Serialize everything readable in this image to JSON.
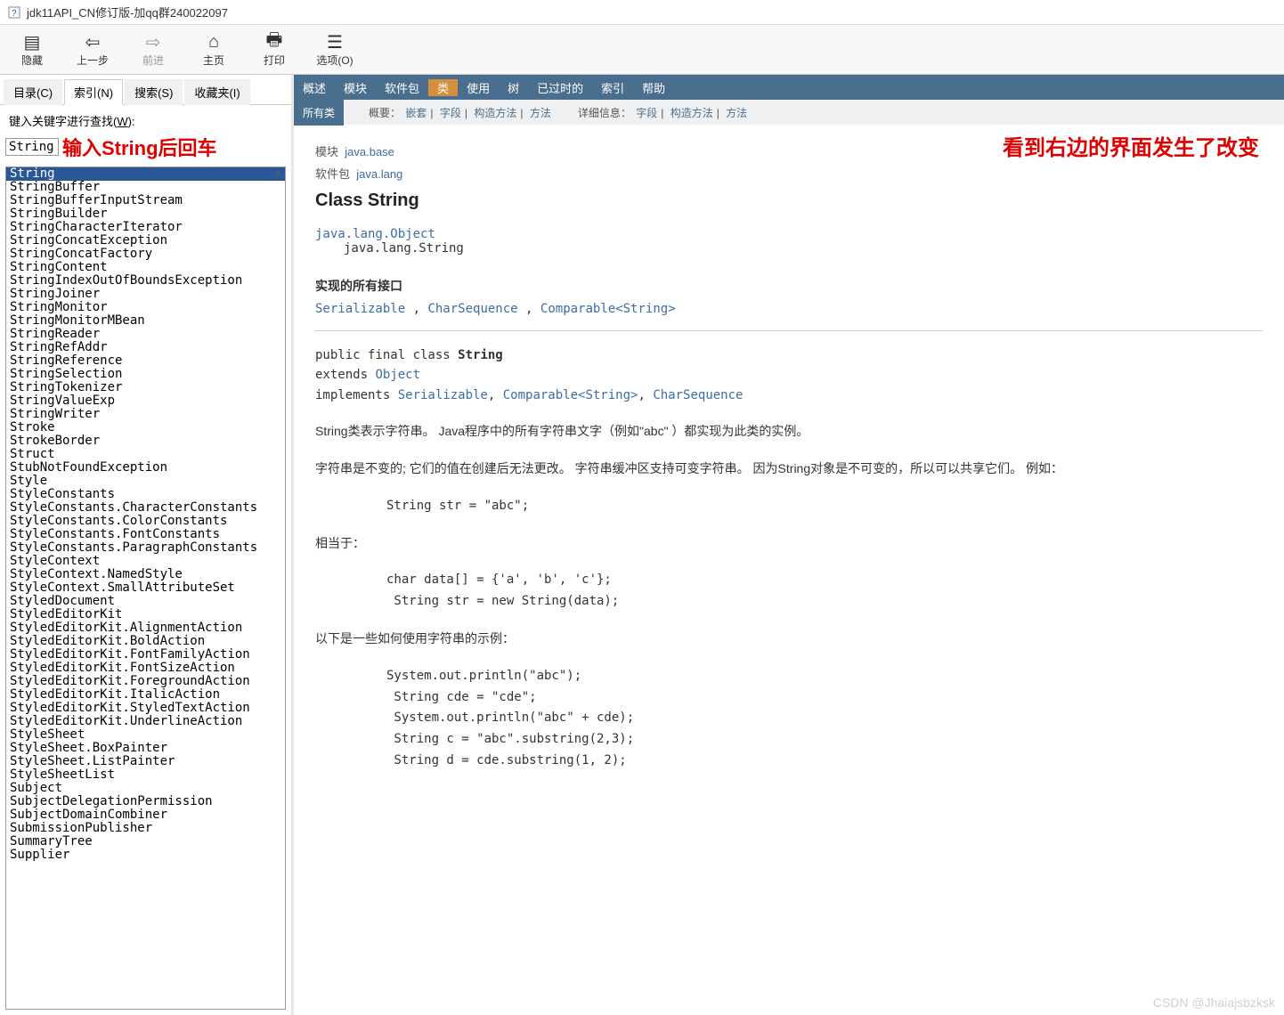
{
  "window": {
    "title": "jdk11API_CN修订版-加qq群240022097"
  },
  "toolbar": {
    "hide": "隐藏",
    "back": "上一步",
    "forward": "前进",
    "home": "主页",
    "print": "打印",
    "options": "选项(O)"
  },
  "left_tabs": {
    "contents": "目录(C)",
    "index": "索引(N)",
    "search": "搜索(S)",
    "fav": "收藏夹(I)"
  },
  "search_label_pre": "键入关键字进行查找(",
  "search_label_key": "W",
  "search_label_post": "):",
  "search_value": "String",
  "hint_left": "输入String后回车",
  "index_items": [
    "String",
    "StringBuffer",
    "StringBufferInputStream",
    "StringBuilder",
    "StringCharacterIterator",
    "StringConcatException",
    "StringConcatFactory",
    "StringContent",
    "StringIndexOutOfBoundsException",
    "StringJoiner",
    "StringMonitor",
    "StringMonitorMBean",
    "StringReader",
    "StringRefAddr",
    "StringReference",
    "StringSelection",
    "StringTokenizer",
    "StringValueExp",
    "StringWriter",
    "Stroke",
    "StrokeBorder",
    "Struct",
    "StubNotFoundException",
    "Style",
    "StyleConstants",
    "StyleConstants.CharacterConstants",
    "StyleConstants.ColorConstants",
    "StyleConstants.FontConstants",
    "StyleConstants.ParagraphConstants",
    "StyleContext",
    "StyleContext.NamedStyle",
    "StyleContext.SmallAttributeSet",
    "StyledDocument",
    "StyledEditorKit",
    "StyledEditorKit.AlignmentAction",
    "StyledEditorKit.BoldAction",
    "StyledEditorKit.FontFamilyAction",
    "StyledEditorKit.FontSizeAction",
    "StyledEditorKit.ForegroundAction",
    "StyledEditorKit.ItalicAction",
    "StyledEditorKit.StyledTextAction",
    "StyledEditorKit.UnderlineAction",
    "StyleSheet",
    "StyleSheet.BoxPainter",
    "StyleSheet.ListPainter",
    "StyleSheetList",
    "Subject",
    "SubjectDelegationPermission",
    "SubjectDomainCombiner",
    "SubmissionPublisher",
    "SummaryTree",
    "Supplier"
  ],
  "selected_index": 0,
  "docnav": {
    "overview": "概述",
    "module": "模块",
    "package": "软件包",
    "class": "类",
    "use": "使用",
    "tree": "树",
    "deprecated": "已过时的",
    "index": "索引",
    "help": "帮助"
  },
  "subnav": {
    "all_classes": "所有类",
    "summary_label": "概要：",
    "nested": "嵌套",
    "field": "字段",
    "constr": "构造方法",
    "method": "方法",
    "detail_label": "详细信息：",
    "dfield": "字段",
    "dconstr": "构造方法",
    "dmethod": "方法"
  },
  "doc": {
    "module_label": "模块",
    "module": "java.base",
    "package_label": "软件包",
    "package": "java.lang",
    "class_title": "Class String",
    "hier1": "java.lang.Object",
    "hier2": "java.lang.String",
    "impl_title": "实现的所有接口",
    "iface1": "Serializable",
    "iface2": "CharSequence",
    "iface3": "Comparable<String>",
    "sig_l1_pre": "public final class ",
    "sig_l1_cls": "String",
    "sig_l2_pre": "extends ",
    "sig_l2_link": "Object",
    "sig_l3_pre": "implements ",
    "sig_l3_a": "Serializable",
    "sig_l3_b": "Comparable<String>",
    "sig_l3_c": "CharSequence",
    "para1": "String类表示字符串。 Java程序中的所有字符串文字（例如\"abc\" ）都实现为此类的实例。",
    "para2": "字符串是不变的; 它们的值在创建后无法更改。 字符串缓冲区支持可变字符串。 因为String对象是不可变的，所以可以共享它们。 例如：",
    "code1": "String str = \"abc\";",
    "equiv": "相当于：",
    "code2": "char data[] = {'a', 'b', 'c'};\n String str = new String(data);",
    "para3": "以下是一些如何使用字符串的示例：",
    "code3": "System.out.println(\"abc\");\n String cde = \"cde\";\n System.out.println(\"abc\" + cde);\n String c = \"abc\".substring(2,3);\n String d = cde.substring(1, 2);"
  },
  "anno_right": "看到右边的界面发生了改变",
  "watermark": "CSDN @Jhaiajsbzksk"
}
